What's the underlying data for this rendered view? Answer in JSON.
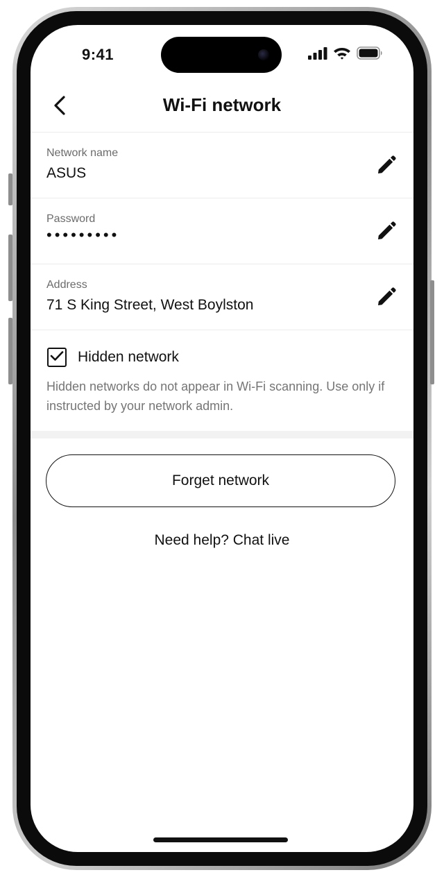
{
  "status_bar": {
    "time": "9:41",
    "icons": [
      "cellular-signal-icon",
      "wifi-icon",
      "battery-icon"
    ]
  },
  "header": {
    "title": "Wi-Fi network",
    "back_icon": "chevron-left-icon"
  },
  "fields": [
    {
      "label": "Network name",
      "value": "ASUS",
      "edit_icon": "pencil-icon"
    },
    {
      "label": "Password",
      "value": "•••••••••",
      "edit_icon": "pencil-icon"
    },
    {
      "label": "Address",
      "value": "71 S King Street, West Boylston",
      "edit_icon": "pencil-icon"
    }
  ],
  "hidden_network": {
    "label": "Hidden network",
    "checked": true,
    "help_text": "Hidden networks do not appear in Wi-Fi scanning. Use only if instructed by your network admin."
  },
  "actions": {
    "forget_label": "Forget network",
    "help_label": "Need help? Chat live"
  },
  "colors": {
    "text": "#111111",
    "secondary_text": "#757575",
    "divider": "#ebebeb",
    "section_fill": "#f2f2f2"
  }
}
